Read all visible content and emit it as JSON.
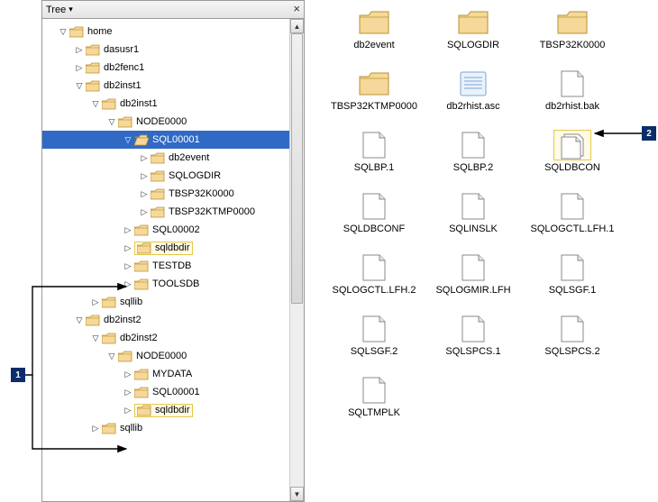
{
  "panel": {
    "title": "Tree",
    "close": "×"
  },
  "tree": [
    {
      "d": 0,
      "t": "open",
      "label": "home"
    },
    {
      "d": 1,
      "t": "closed",
      "label": "dasusr1"
    },
    {
      "d": 1,
      "t": "closed",
      "label": "db2fenc1"
    },
    {
      "d": 1,
      "t": "open",
      "label": "db2inst1"
    },
    {
      "d": 2,
      "t": "open",
      "label": "db2inst1"
    },
    {
      "d": 3,
      "t": "open",
      "label": "NODE0000"
    },
    {
      "d": 4,
      "t": "open",
      "label": "SQL00001",
      "selected": true,
      "open_folder": true
    },
    {
      "d": 5,
      "t": "closed",
      "label": "db2event"
    },
    {
      "d": 5,
      "t": "closed",
      "label": "SQLOGDIR"
    },
    {
      "d": 5,
      "t": "closed",
      "label": "TBSP32K0000"
    },
    {
      "d": 5,
      "t": "closed",
      "label": "TBSP32KTMP0000"
    },
    {
      "d": 4,
      "t": "closed",
      "label": "SQL00002"
    },
    {
      "d": 4,
      "t": "closed",
      "label": "sqldbdir",
      "hl": true
    },
    {
      "d": 4,
      "t": "closed",
      "label": "TESTDB"
    },
    {
      "d": 4,
      "t": "closed",
      "label": "TOOLSDB"
    },
    {
      "d": 2,
      "t": "closed",
      "label": "sqllib"
    },
    {
      "d": 1,
      "t": "open",
      "label": "db2inst2"
    },
    {
      "d": 2,
      "t": "open",
      "label": "db2inst2"
    },
    {
      "d": 3,
      "t": "open",
      "label": "NODE0000"
    },
    {
      "d": 4,
      "t": "closed",
      "label": "MYDATA"
    },
    {
      "d": 4,
      "t": "closed",
      "label": "SQL00001"
    },
    {
      "d": 4,
      "t": "closed",
      "label": "sqldbdir",
      "hl": true
    },
    {
      "d": 2,
      "t": "closed",
      "label": "sqllib"
    }
  ],
  "files": [
    {
      "label": "db2event",
      "type": "folder"
    },
    {
      "label": "SQLOGDIR",
      "type": "folder"
    },
    {
      "label": "TBSP32K0000",
      "type": "folder"
    },
    {
      "label": "TBSP32KTMP0000",
      "type": "folder"
    },
    {
      "label": "db2rhist.asc",
      "type": "doc-lined"
    },
    {
      "label": "db2rhist.bak",
      "type": "doc"
    },
    {
      "label": "SQLBP.1",
      "type": "doc"
    },
    {
      "label": "SQLBP.2",
      "type": "doc"
    },
    {
      "label": "SQLDBCON",
      "type": "doc-stack",
      "selected": true
    },
    {
      "label": "SQLDBCONF",
      "type": "doc"
    },
    {
      "label": "SQLINSLK",
      "type": "doc"
    },
    {
      "label": "SQLOGCTL.LFH.1",
      "type": "doc"
    },
    {
      "label": "SQLOGCTL.LFH.2",
      "type": "doc"
    },
    {
      "label": "SQLOGMIR.LFH",
      "type": "doc"
    },
    {
      "label": "SQLSGF.1",
      "type": "doc"
    },
    {
      "label": "SQLSGF.2",
      "type": "doc"
    },
    {
      "label": "SQLSPCS.1",
      "type": "doc"
    },
    {
      "label": "SQLSPCS.2",
      "type": "doc"
    },
    {
      "label": "SQLTMPLK",
      "type": "doc"
    }
  ],
  "callouts": {
    "one": "1",
    "two": "2"
  }
}
